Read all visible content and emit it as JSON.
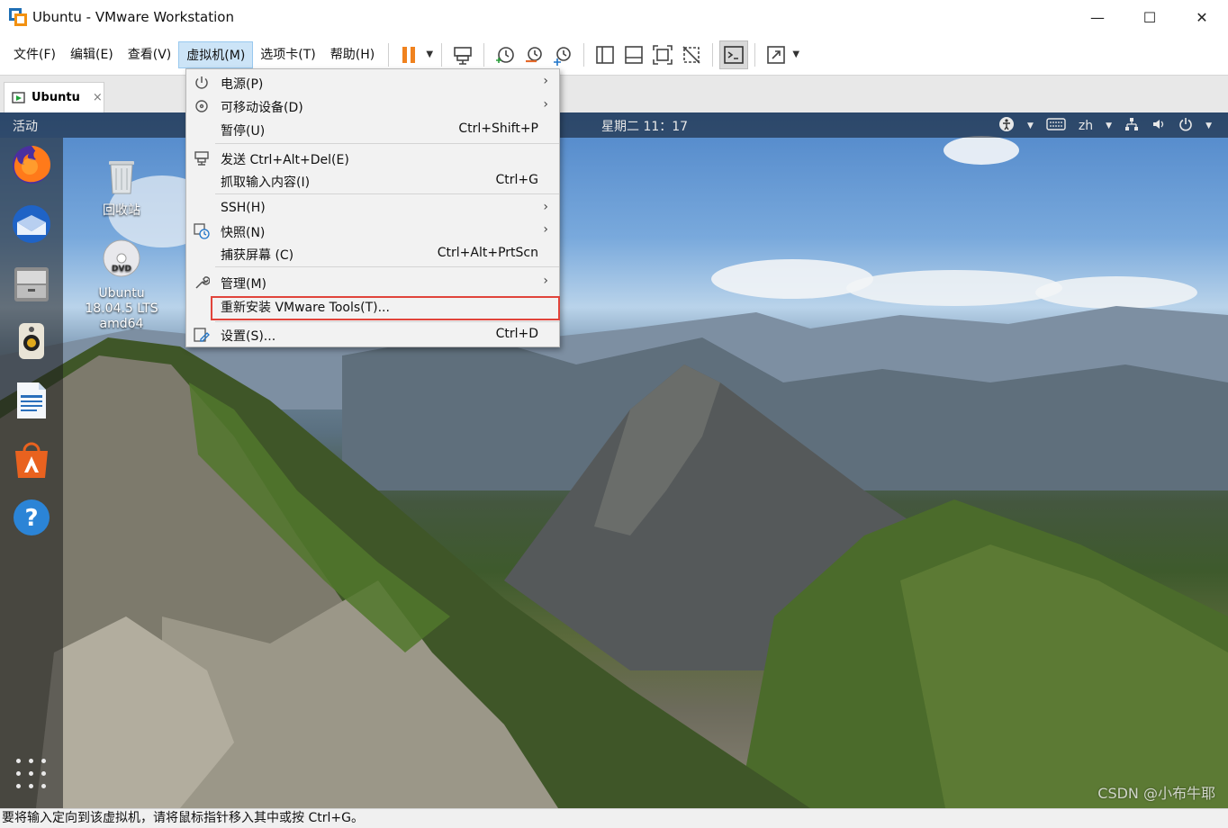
{
  "window": {
    "title": "Ubuntu - VMware Workstation",
    "controls": {
      "minimize": "—",
      "maximize": "☐",
      "close": "✕"
    }
  },
  "menubar": {
    "items": [
      {
        "label": "文件(F)"
      },
      {
        "label": "编辑(E)"
      },
      {
        "label": "查看(V)"
      },
      {
        "label": "虚拟机(M)",
        "active": true
      },
      {
        "label": "选项卡(T)"
      },
      {
        "label": "帮助(H)"
      }
    ]
  },
  "toolbar": {
    "icons": [
      "pause-icon",
      "send-ctrl-alt-del-icon",
      "snapshot-icon",
      "revert-snapshot-icon",
      "snapshot-manager-icon",
      "library-icon",
      "thumbnail-icon",
      "fullscreen-icon",
      "unity-icon",
      "console-view-icon",
      "stretch-icon"
    ]
  },
  "tab": {
    "label": "Ubuntu",
    "close": "×"
  },
  "guest": {
    "topbar": {
      "activities": "活动",
      "clock": "星期二 11：17",
      "language": "zh"
    },
    "desktop_icons": [
      {
        "label": "回收站"
      },
      {
        "label_lines": [
          "Ubuntu",
          "18.04.5 LTS",
          "amd64"
        ]
      }
    ],
    "dock": [
      "firefox-icon",
      "thunderbird-icon",
      "files-icon",
      "rhythmbox-icon",
      "writer-icon",
      "software-center-icon",
      "help-icon"
    ]
  },
  "dropdown": {
    "items": [
      {
        "label": "电源(P)",
        "shortcut": "",
        "submenu": true,
        "icon": "power-icon"
      },
      {
        "label": "可移动设备(D)",
        "shortcut": "",
        "submenu": true,
        "icon": "removable-device-icon"
      },
      {
        "label": "暂停(U)",
        "shortcut": "Ctrl+Shift+P",
        "submenu": false,
        "icon": ""
      },
      {
        "label": "发送 Ctrl+Alt+Del(E)",
        "shortcut": "",
        "submenu": false,
        "icon": "send-keys-icon"
      },
      {
        "label": "抓取输入内容(I)",
        "shortcut": "Ctrl+G",
        "submenu": false,
        "icon": ""
      },
      {
        "label": "SSH(H)",
        "shortcut": "",
        "submenu": true,
        "icon": ""
      },
      {
        "label": "快照(N)",
        "shortcut": "",
        "submenu": true,
        "icon": "snapshot-icon"
      },
      {
        "label": "捕获屏幕 (C)",
        "shortcut": "Ctrl+Alt+PrtScn",
        "submenu": false,
        "icon": ""
      },
      {
        "label": "管理(M)",
        "shortcut": "",
        "submenu": true,
        "icon": "wrench-icon"
      },
      {
        "label": "重新安装 VMware Tools(T)...",
        "shortcut": "",
        "submenu": false,
        "icon": "",
        "highlighted": true
      },
      {
        "label": "设置(S)...",
        "shortcut": "Ctrl+D",
        "submenu": false,
        "icon": "settings-icon"
      }
    ],
    "submenu_arrow": "›",
    "highlight_color": "#e1443b"
  },
  "statusbar": {
    "text": "要将输入定向到该虚拟机，请将鼠标指针移入其中或按 Ctrl+G。"
  },
  "watermark": "CSDN @小布牛耶"
}
